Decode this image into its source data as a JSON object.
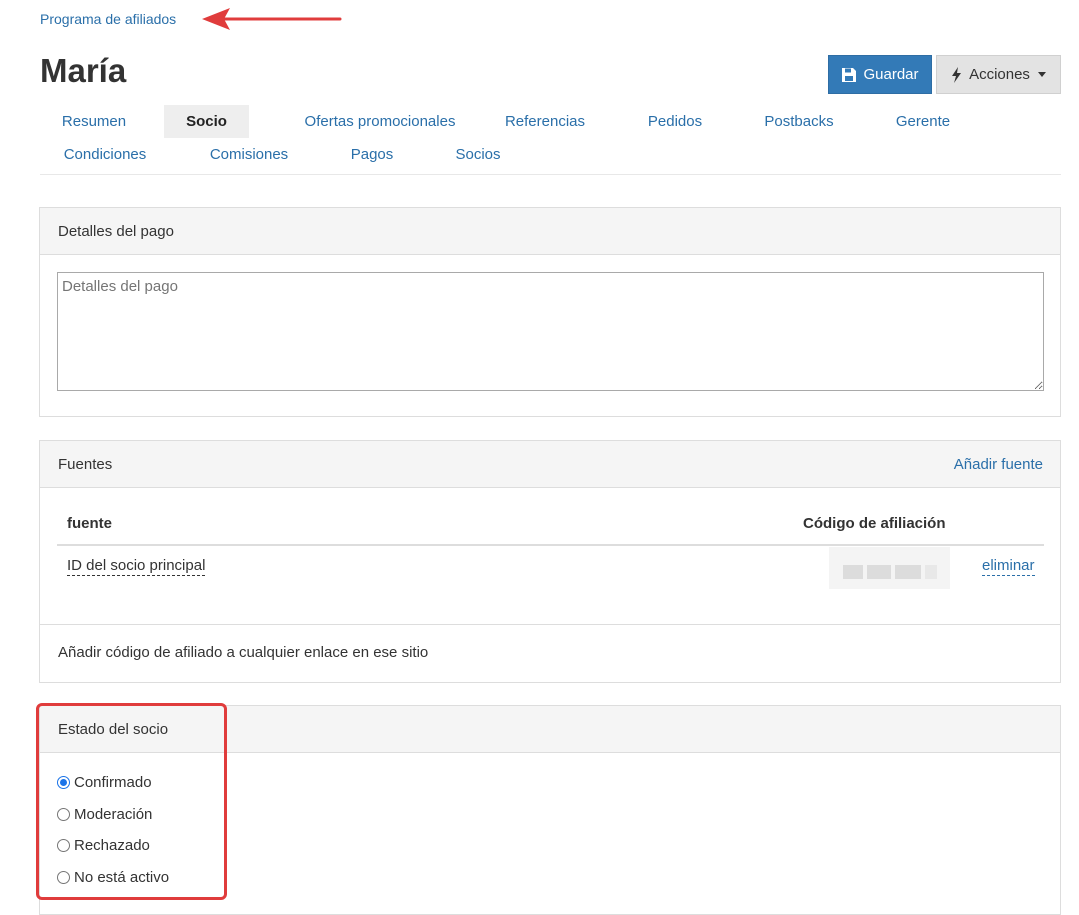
{
  "breadcrumb": {
    "label": "Programa de afiliados"
  },
  "header": {
    "title": "María",
    "save_label": "Guardar",
    "actions_label": "Acciones"
  },
  "tabs": [
    {
      "label": "Resumen"
    },
    {
      "label": "Socio"
    },
    {
      "label": "Ofertas promocionales"
    },
    {
      "label": "Referencias"
    },
    {
      "label": "Pedidos"
    },
    {
      "label": "Postbacks"
    },
    {
      "label": "Gerente"
    },
    {
      "label": "Condiciones"
    },
    {
      "label": "Comisiones"
    },
    {
      "label": "Pagos"
    },
    {
      "label": "Socios"
    }
  ],
  "active_tab": "Socio",
  "payment": {
    "title": "Detalles del pago",
    "placeholder": "Detalles del pago",
    "value": ""
  },
  "sources": {
    "title": "Fuentes",
    "add_label": "Añadir fuente",
    "columns": {
      "source": "fuente",
      "code": "Código de afiliación"
    },
    "rows": [
      {
        "source": "ID del socio principal",
        "delete_label": "eliminar"
      }
    ],
    "note": "Añadir código de afiliado a cualquier enlace en ese sitio"
  },
  "status": {
    "title": "Estado del socio",
    "options": [
      {
        "label": "Confirmado",
        "checked": true
      },
      {
        "label": "Moderación",
        "checked": false
      },
      {
        "label": "Rechazado",
        "checked": false
      },
      {
        "label": "No está activo",
        "checked": false
      }
    ]
  },
  "colors": {
    "link": "#2a6fa9",
    "primary": "#337ab7",
    "highlight": "#e03c3c",
    "radio_checked": "#1a73e8"
  }
}
